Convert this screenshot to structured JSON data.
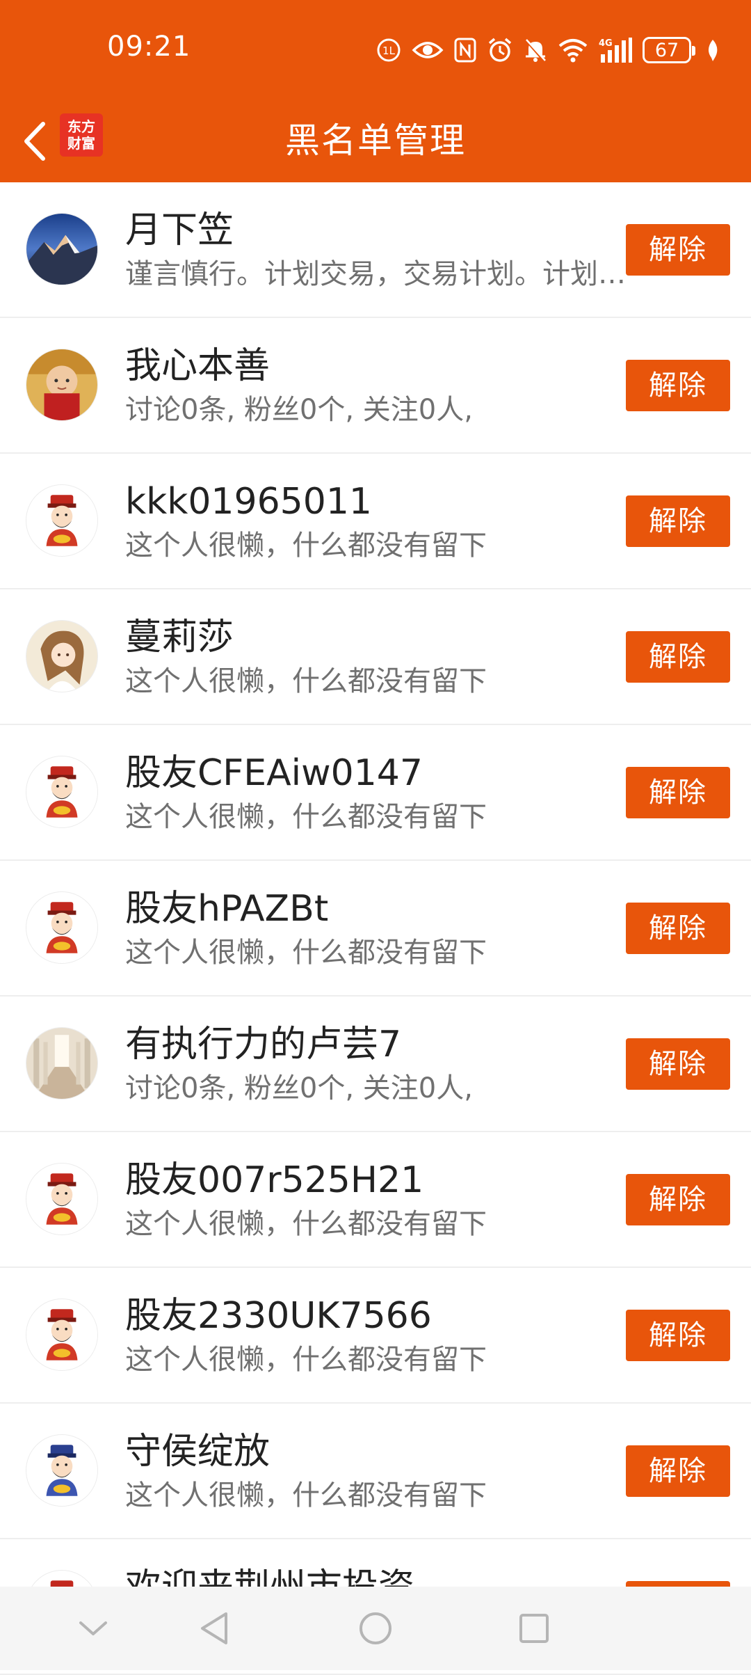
{
  "status_bar": {
    "time": "09:21",
    "battery_level": "67",
    "icons": [
      "hd-call-icon",
      "eye-icon",
      "nfc-icon",
      "alarm-icon",
      "mute-icon",
      "wifi-icon",
      "4g-signal-icon",
      "battery-icon",
      "leaf-icon"
    ]
  },
  "nav": {
    "title": "黑名单管理",
    "logo_line1": "东方",
    "logo_line2": "财富",
    "back_icon": "chevron-left-icon"
  },
  "users": [
    {
      "name": "月下笠",
      "desc": "谨言慎行。计划交易，交易计划。计划交易，交易计划",
      "avatar": "mountain-photo"
    },
    {
      "name": "我心本善",
      "desc": "讨论0条, 粉丝0个, 关注0人,",
      "avatar": "child-photo"
    },
    {
      "name": "kkk01965011",
      "desc": "这个人很懒，什么都没有留下",
      "avatar": "fortune-god-red"
    },
    {
      "name": "蔓莉莎",
      "desc": "这个人很懒，什么都没有留下",
      "avatar": "anime-girl-photo"
    },
    {
      "name": "股友CFEAiw0147",
      "desc": "这个人很懒，什么都没有留下",
      "avatar": "fortune-god-red"
    },
    {
      "name": "股友hPAZBt",
      "desc": "这个人很懒，什么都没有留下",
      "avatar": "fortune-god-red"
    },
    {
      "name": "有执行力的卢芸7",
      "desc": "讨论0条, 粉丝0个, 关注0人,",
      "avatar": "cathedral-photo"
    },
    {
      "name": "股友007r525H21",
      "desc": "这个人很懒，什么都没有留下",
      "avatar": "fortune-god-red"
    },
    {
      "name": "股友2330UK7566",
      "desc": "这个人很懒，什么都没有留下",
      "avatar": "fortune-god-red"
    },
    {
      "name": "守侯绽放",
      "desc": "这个人很懒，什么都没有留下",
      "avatar": "fortune-god-blue"
    },
    {
      "name": "欢迎来荆州市投资",
      "desc": "",
      "avatar": "fortune-god-red"
    }
  ],
  "unblock_label": "解除",
  "system_nav": [
    "collapse-icon",
    "back-triangle-icon",
    "home-circle-icon",
    "recents-square-icon"
  ],
  "colors": {
    "accent": "#e8550b",
    "logo_red": "#e73224"
  }
}
